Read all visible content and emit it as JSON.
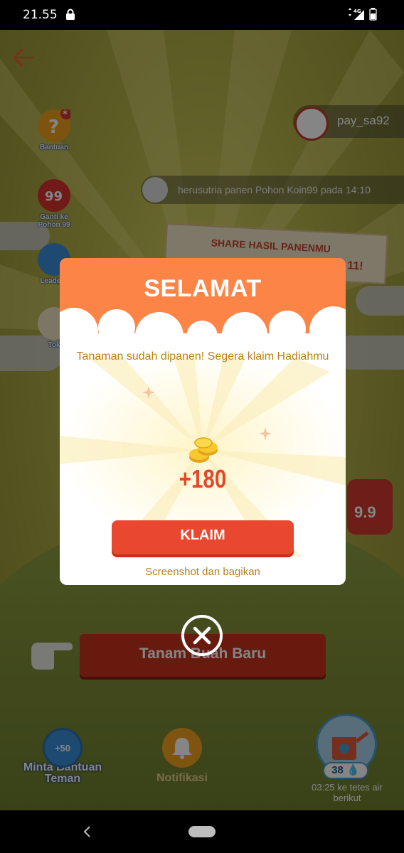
{
  "status_bar": {
    "time": "21.55",
    "network": "4G"
  },
  "game": {
    "side_buttons": [
      {
        "label": "Bantuan"
      },
      {
        "label": "Ganti ke Pohon 99",
        "badge": "99"
      },
      {
        "label": "Leaderb"
      },
      {
        "label": "Tok"
      }
    ],
    "username": "pay_sa92",
    "feed_text": "herusutria panen Pohon Koin99 pada 14:10",
    "banner_text": "SHARE HASIL PANENMU",
    "banner_tail": "E 11!",
    "plant_button": "Tanam Buah Baru",
    "pot_label": "9.9",
    "bottom": {
      "help_label": "Minta Bantuan Teman",
      "help_badge": "+50",
      "notif_label": "Notifikasi",
      "water_count": "38",
      "timer_text": "03:25 ke tetes air berikut"
    }
  },
  "modal": {
    "title": "SELAMAT",
    "message": "Tanaman sudah dipanen! Segera klaim Hadiahmu",
    "reward": "+180",
    "claim_button": "KLAIM",
    "share_text": "Screenshot dan bagikan"
  },
  "colors": {
    "modal_header": "#fd8447",
    "claim_button": "#e9472f",
    "reward_text": "#e1492b",
    "message_text": "#b97f1e"
  }
}
